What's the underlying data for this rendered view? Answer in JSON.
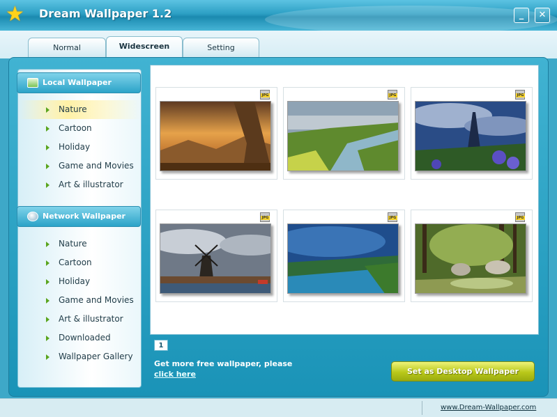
{
  "window": {
    "title": "Dream Wallpaper 1.2",
    "minimize_glyph": "_",
    "close_glyph": "✕",
    "icon": "star-icon"
  },
  "tabs": [
    {
      "label": "Normal",
      "selected": false
    },
    {
      "label": "Widescreen",
      "selected": true
    },
    {
      "label": "Setting",
      "selected": false
    }
  ],
  "sidebar": {
    "local": {
      "title": "Local Wallpaper",
      "items": [
        "Nature",
        "Cartoon",
        "Holiday",
        "Game and Movies",
        "Art & illustrator"
      ],
      "active_index": 0
    },
    "network": {
      "title": "Network Wallpaper",
      "items": [
        "Nature",
        "Cartoon",
        "Holiday",
        "Game and Movies",
        "Art & illustrator",
        "Downloaded",
        "Wallpaper Gallery"
      ]
    }
  },
  "gallery": {
    "items": [
      {
        "badge": "JPG"
      },
      {
        "badge": "JPG"
      },
      {
        "badge": "JPG"
      },
      {
        "badge": "JPG"
      },
      {
        "badge": "JPG"
      },
      {
        "badge": "JPG"
      }
    ]
  },
  "pagination": {
    "current": "1"
  },
  "footer": {
    "promo_text": "Get more free wallpaper, please",
    "promo_link": "click here",
    "set_button": "Set as Desktop Wallpaper"
  },
  "status": {
    "site": "www.Dream-Wallpaper.com"
  },
  "colors": {
    "accent": "#2aa3c8",
    "button_green": "#b9c81a",
    "active_item": "#fff1a6"
  }
}
